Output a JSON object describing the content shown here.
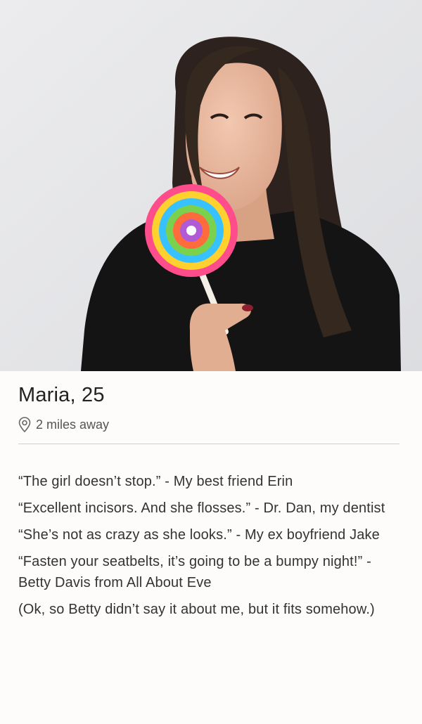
{
  "profile": {
    "name_age": "Maria, 25",
    "distance": "2 miles away",
    "photo_icon": "profile-photo",
    "location_icon": "location-pin-icon",
    "accent_colors": {
      "text_primary": "#222222",
      "text_secondary": "#555555",
      "divider": "#cfcfcf",
      "background": "#fdfcfb"
    }
  },
  "bio": {
    "quotes": [
      "“The girl doesn’t stop.” - My best friend Erin",
      "“Excellent incisors. And she flosses.” - Dr. Dan, my dentist",
      "“She’s not as crazy as she looks.” - My ex boyfriend Jake",
      "“Fasten your seatbelts, it’s going to be a bumpy night!” - Betty Davis from All About Eve",
      "(Ok, so Betty didn’t say it about me, but it fits somehow.)"
    ]
  }
}
